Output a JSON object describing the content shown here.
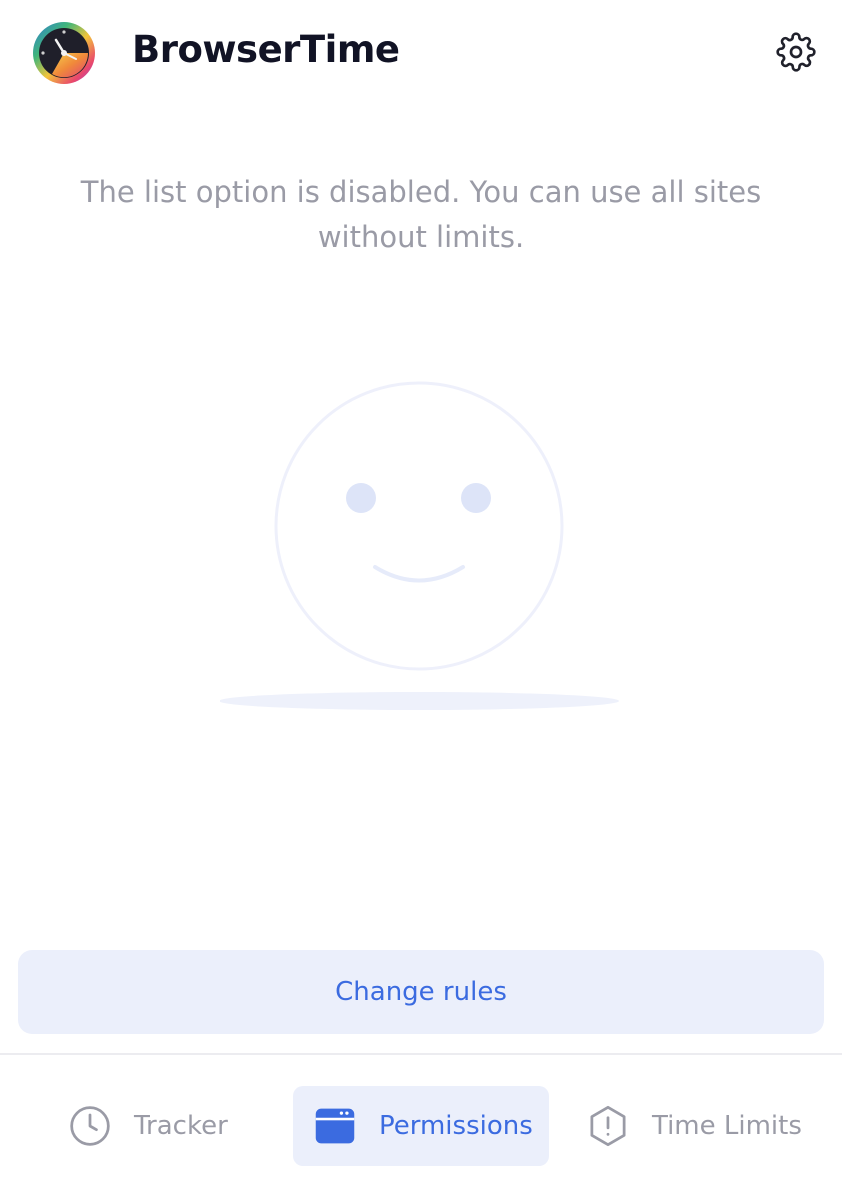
{
  "app": {
    "title": "BrowserTime",
    "logo_icon": "stopwatch-logo-icon",
    "settings_icon": "gear-icon"
  },
  "main": {
    "message": "The list option is disabled. You can use all sites without limits.",
    "illustration_icon": "smiley-face-icon"
  },
  "actions": {
    "change_rules_label": "Change rules"
  },
  "nav": {
    "items": [
      {
        "label": "Tracker",
        "icon": "clock-icon",
        "active": false
      },
      {
        "label": "Permissions",
        "icon": "browser-window-icon",
        "active": true
      },
      {
        "label": "Time Limits",
        "icon": "alert-octagon-icon",
        "active": false
      }
    ]
  },
  "colors": {
    "accent": "#3b6be0",
    "accent_bg": "#ebeffb",
    "title": "#111325",
    "muted": "#9a9ba6"
  }
}
